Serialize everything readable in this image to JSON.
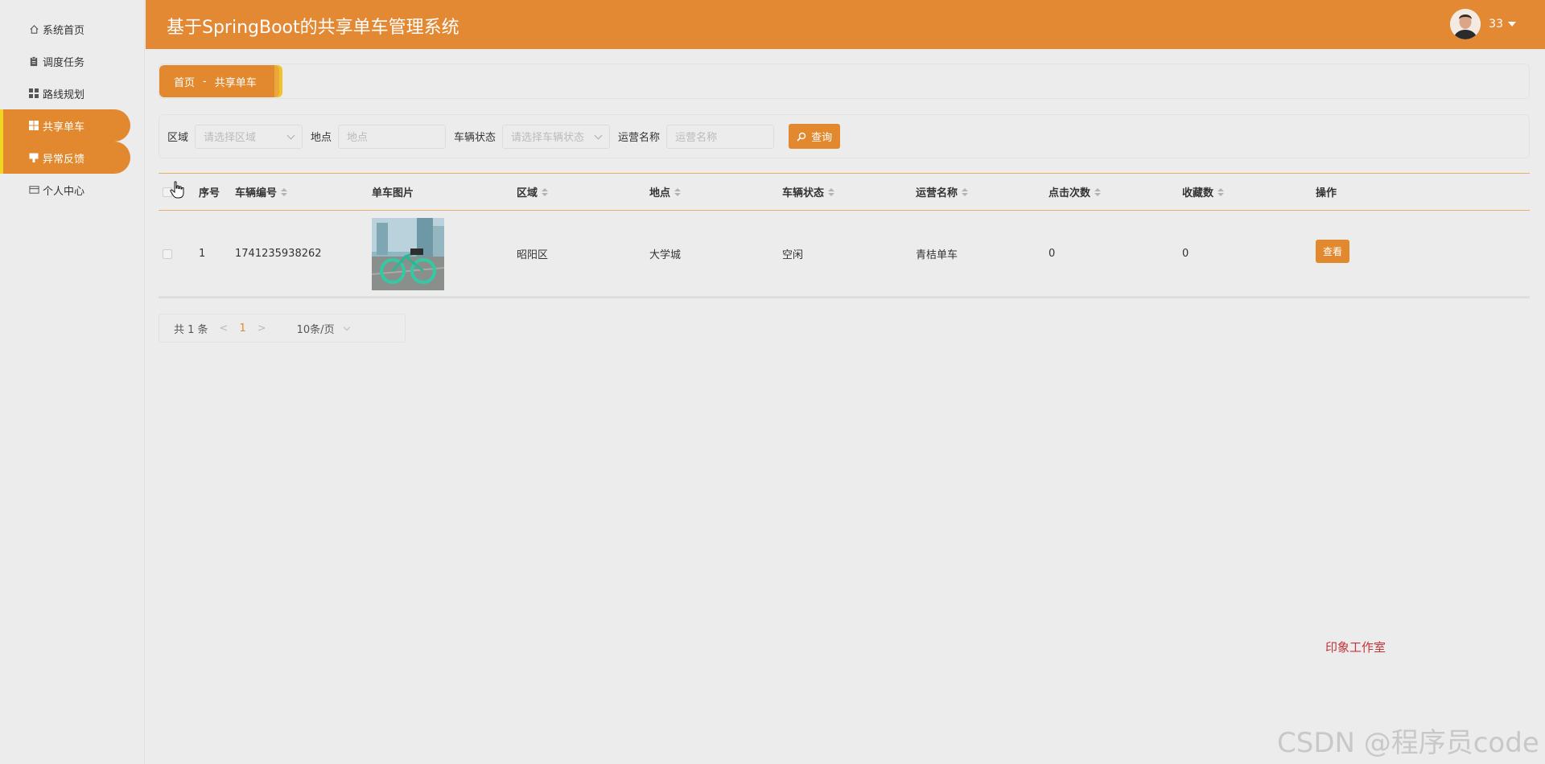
{
  "app": {
    "title": "基于SpringBoot的共享单车管理系统"
  },
  "user": {
    "name": "33"
  },
  "sidebar": {
    "items": [
      {
        "label": "系统首页",
        "icon": "home-icon"
      },
      {
        "label": "调度任务",
        "icon": "clipboard-icon"
      },
      {
        "label": "路线规划",
        "icon": "grid-icon"
      },
      {
        "label": "共享单车",
        "icon": "grid-icon",
        "active": true
      },
      {
        "label": "异常反馈",
        "icon": "flag-icon",
        "active": true
      },
      {
        "label": "个人中心",
        "icon": "card-icon"
      }
    ]
  },
  "breadcrumb": {
    "home": "首页",
    "separator": "-",
    "current": "共享单车"
  },
  "search": {
    "region_label": "区域",
    "region_placeholder": "请选择区域",
    "location_label": "地点",
    "location_placeholder": "地点",
    "status_label": "车辆状态",
    "status_placeholder": "请选择车辆状态",
    "operator_label": "运营名称",
    "operator_placeholder": "运营名称",
    "query_button": "查询"
  },
  "table": {
    "columns": [
      "序号",
      "车辆编号",
      "单车图片",
      "区域",
      "地点",
      "车辆状态",
      "运营名称",
      "点击次数",
      "收藏数",
      "操作"
    ],
    "rows": [
      {
        "index": "1",
        "bike_no": "1741235938262",
        "region": "昭阳区",
        "location": "大学城",
        "status": "空闲",
        "operator": "青桔单车",
        "clicks": "0",
        "favorites": "0",
        "action": "查看"
      }
    ]
  },
  "pagination": {
    "total": "共 1 条",
    "prev": "<",
    "page": "1",
    "next": ">",
    "page_size": "10条/页"
  },
  "footer": {
    "studio": "印象工作室",
    "watermark": "CSDN @程序员code"
  },
  "colors": {
    "accent": "#e2892f",
    "header": "#e38833",
    "highlight": "#f2d422",
    "studio_text": "#c2343b"
  }
}
